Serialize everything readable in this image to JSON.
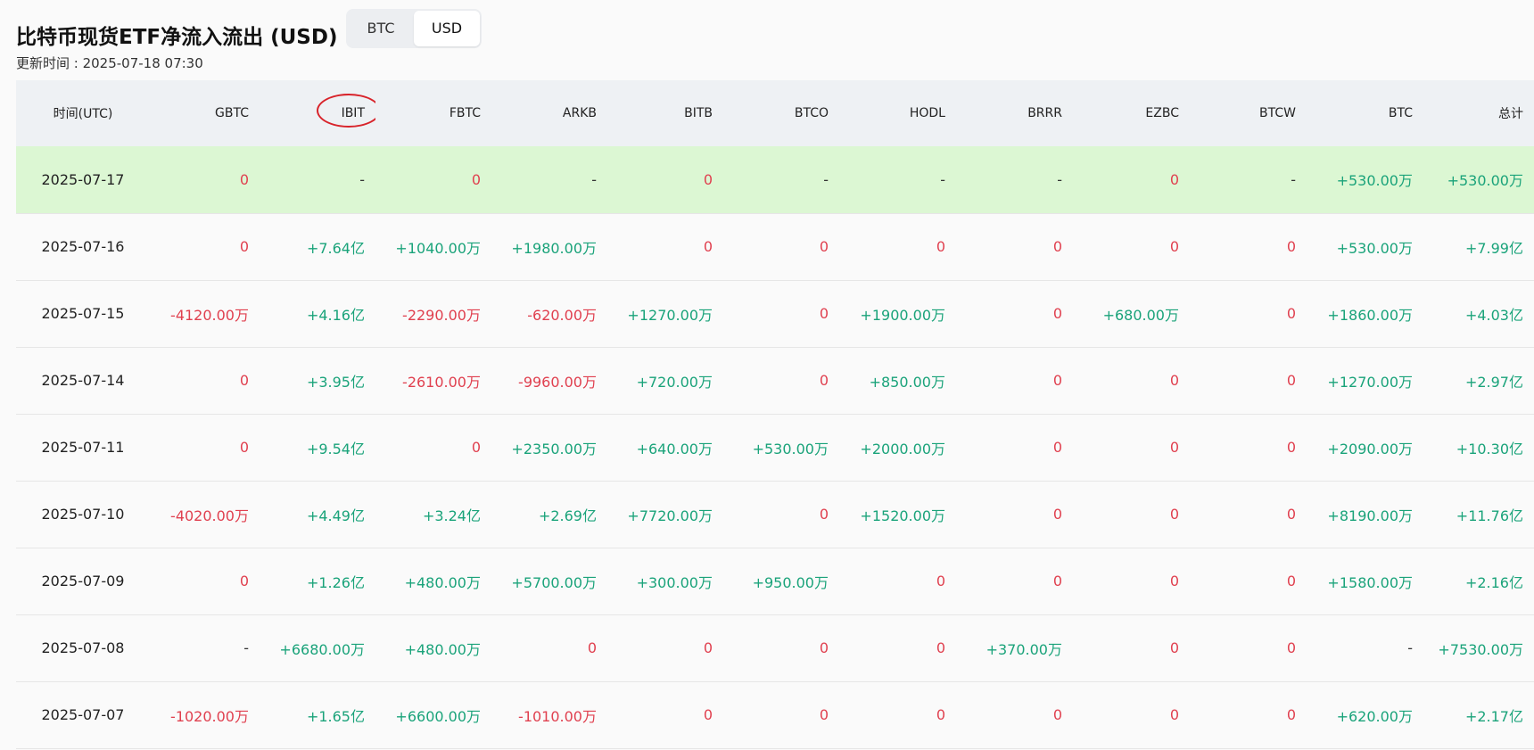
{
  "header": {
    "title": "比特币现货ETF净流入流出 (USD)",
    "updated": "更新时间 : 2025-07-18 07:30",
    "toggle": [
      "BTC",
      "USD"
    ],
    "toggle_active": "USD"
  },
  "table": {
    "columns": [
      "时间(UTC)",
      "GBTC",
      "IBIT",
      "FBTC",
      "ARKB",
      "BITB",
      "BTCO",
      "HODL",
      "BRRR",
      "EZBC",
      "BTCW",
      "BTC",
      "总计"
    ],
    "highlight_column": "IBIT",
    "rows": [
      {
        "date": "2025-07-17",
        "cells": [
          "0",
          "-",
          "0",
          "-",
          "0",
          "-",
          "-",
          "-",
          "0",
          "-",
          "+530.00万",
          "+530.00万"
        ],
        "highlighted": true
      },
      {
        "date": "2025-07-16",
        "cells": [
          "0",
          "+7.64亿",
          "+1040.00万",
          "+1980.00万",
          "0",
          "0",
          "0",
          "0",
          "0",
          "0",
          "+530.00万",
          "+7.99亿"
        ]
      },
      {
        "date": "2025-07-15",
        "cells": [
          "-4120.00万",
          "+4.16亿",
          "-2290.00万",
          "-620.00万",
          "+1270.00万",
          "0",
          "+1900.00万",
          "0",
          "+680.00万",
          "0",
          "+1860.00万",
          "+4.03亿"
        ]
      },
      {
        "date": "2025-07-14",
        "cells": [
          "0",
          "+3.95亿",
          "-2610.00万",
          "-9960.00万",
          "+720.00万",
          "0",
          "+850.00万",
          "0",
          "0",
          "0",
          "+1270.00万",
          "+2.97亿"
        ]
      },
      {
        "date": "2025-07-11",
        "cells": [
          "0",
          "+9.54亿",
          "0",
          "+2350.00万",
          "+640.00万",
          "+530.00万",
          "+2000.00万",
          "0",
          "0",
          "0",
          "+2090.00万",
          "+10.30亿"
        ]
      },
      {
        "date": "2025-07-10",
        "cells": [
          "-4020.00万",
          "+4.49亿",
          "+3.24亿",
          "+2.69亿",
          "+7720.00万",
          "0",
          "+1520.00万",
          "0",
          "0",
          "0",
          "+8190.00万",
          "+11.76亿"
        ]
      },
      {
        "date": "2025-07-09",
        "cells": [
          "0",
          "+1.26亿",
          "+480.00万",
          "+5700.00万",
          "+300.00万",
          "+950.00万",
          "0",
          "0",
          "0",
          "0",
          "+1580.00万",
          "+2.16亿"
        ]
      },
      {
        "date": "2025-07-08",
        "cells": [
          "-",
          "+6680.00万",
          "+480.00万",
          "0",
          "0",
          "0",
          "0",
          "+370.00万",
          "0",
          "0",
          "-",
          "+7530.00万"
        ]
      },
      {
        "date": "2025-07-07",
        "cells": [
          "-1020.00万",
          "+1.65亿",
          "+6600.00万",
          "-1010.00万",
          "0",
          "0",
          "0",
          "0",
          "0",
          "0",
          "+620.00万",
          "+2.17亿"
        ]
      }
    ]
  },
  "colors": {
    "positive": "#1aa37a",
    "negative": "#e0404f",
    "highlight_row": "#dcf7d3",
    "annotation_circle": "#d8232a"
  }
}
